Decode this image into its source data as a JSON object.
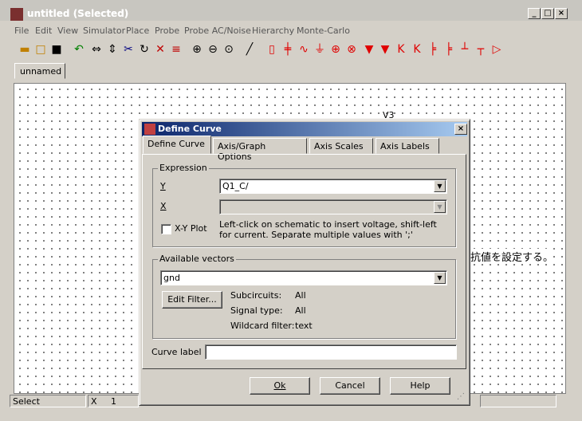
{
  "window": {
    "title": "untitled (Selected)",
    "min_label": "_",
    "max_label": "□",
    "close_label": "×"
  },
  "menu": [
    "File",
    "Edit",
    "View",
    "Simulator",
    "Place",
    "Probe",
    "Probe AC/Noise",
    "Hierarchy",
    "Monte-Carlo"
  ],
  "toolbar_icons": [
    "open-icon",
    "new-icon",
    "save-icon",
    "undo-icon",
    "mirror-icon",
    "flip-icon",
    "cut-icon",
    "rotate-icon",
    "delete-icon",
    "duplicate-icon",
    "zoom-in-icon",
    "zoom-out-icon",
    "zoom-full-icon",
    "wire-icon",
    "resistor-icon",
    "capacitor-icon",
    "inductor-icon",
    "ground-icon",
    "source-icon",
    "current-source-icon",
    "diode-icon",
    "zener-icon",
    "npn-icon",
    "pnp-icon",
    "nmos-icon",
    "pmos-icon",
    "jfet-icon",
    "jfet-p-icon",
    "opamp-icon"
  ],
  "doc_tab": "unnamed",
  "canvas": {
    "label_v3": "V3",
    "japanese_text": "抗値を設定する。"
  },
  "status": {
    "mode": "Select",
    "x_label": "X",
    "x_value": "1"
  },
  "dialog": {
    "title": "Define Curve",
    "close_label": "×",
    "tabs": [
      "Define Curve",
      "Axis/Graph Options",
      "Axis Scales",
      "Axis Labels"
    ],
    "expression": {
      "legend": "Expression",
      "y_label": "Y",
      "y_value": "Q1_C/",
      "x_label": "X",
      "x_value": "",
      "xy_plot_label": "X-Y Plot",
      "hint": "Left-click on schematic to insert voltage, shift-left for current. Separate multiple values with ';'"
    },
    "vectors": {
      "legend": "Available vectors",
      "selected": "gnd",
      "edit_filter": "Edit Filter...",
      "subcircuits_label": "Subcircuits:",
      "subcircuits_value": "All",
      "signal_type_label": "Signal type:",
      "signal_type_value": "All",
      "wildcard_label": "Wildcard filter:",
      "wildcard_value": "text"
    },
    "curve_label": "Curve label",
    "curve_value": "",
    "ok": "Ok",
    "cancel": "Cancel",
    "help": "Help"
  }
}
